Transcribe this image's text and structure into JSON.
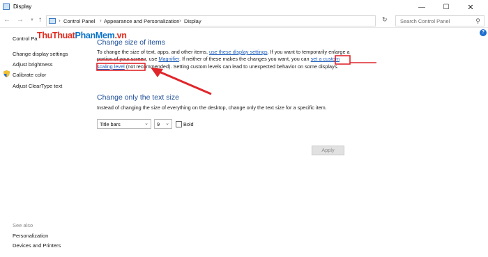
{
  "window": {
    "title": "Display"
  },
  "address": {
    "crumbs": [
      "Control Panel",
      "Appearance and Personalization",
      "Display"
    ],
    "search_placeholder": "Search Control Panel"
  },
  "sidebar": {
    "home": "Control Pa",
    "links": [
      "Change display settings",
      "Adjust brightness",
      "Calibrate color",
      "Adjust ClearType text"
    ],
    "see_also_label": "See also",
    "see_also": [
      "Personalization",
      "Devices and Printers"
    ]
  },
  "watermark": {
    "part1": "ThuThuat",
    "part2": "PhanMem",
    "part3": ".vn"
  },
  "section1": {
    "title": "Change size of items",
    "t1": "To change the size of text, apps, and other items, ",
    "link1": "use these display settings",
    "t2": ". If you want to temporarily enlarge a portion of your screen, use ",
    "link2": "Magnifier",
    "t3": ". If neither of these makes the changes you want, you can ",
    "link3": "set a custom scaling level",
    "t4": " (not recommended). Setting custom levels can lead to unexpected behavior on some displays."
  },
  "section2": {
    "title": "Change only the text size",
    "desc": "Instead of changing the size of everything on the desktop, change only the text size for a specific item.",
    "item_select": "Title bars",
    "size_select": "9",
    "bold_label": "Bold",
    "apply_label": "Apply"
  },
  "colors": {
    "heading": "#1e4f9a",
    "link": "#1c5bb8",
    "annotation": "#e0262b"
  }
}
